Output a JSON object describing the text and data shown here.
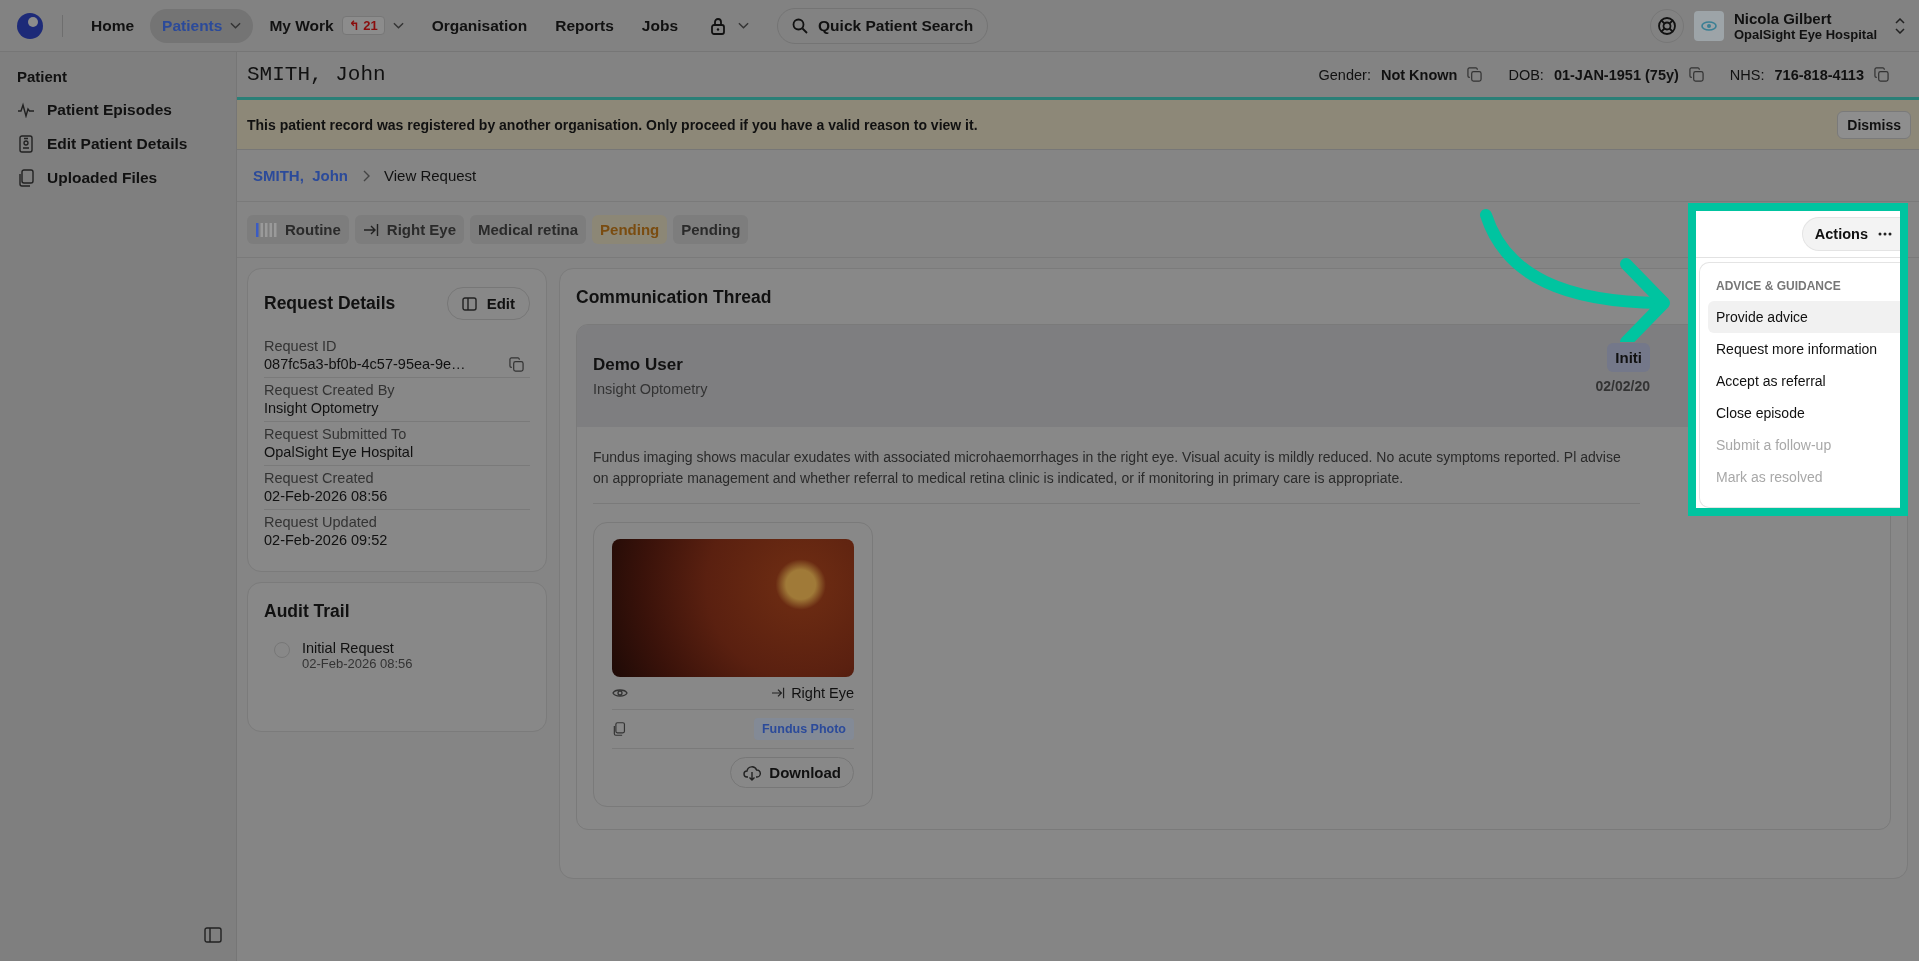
{
  "nav": {
    "items": [
      {
        "kind": "link",
        "label": "Home",
        "selected": false,
        "dropdown": false
      },
      {
        "kind": "link",
        "label": "Patients",
        "selected": true,
        "dropdown": true
      },
      {
        "kind": "work",
        "label": "My Work",
        "badge": "↰ 21",
        "selected": false,
        "dropdown": true
      },
      {
        "kind": "link",
        "label": "Organisation",
        "selected": false,
        "dropdown": false
      },
      {
        "kind": "link",
        "label": "Reports",
        "selected": false,
        "dropdown": false
      },
      {
        "kind": "link",
        "label": "Jobs",
        "selected": false,
        "dropdown": false
      },
      {
        "kind": "lock",
        "selected": false,
        "dropdown": true
      }
    ],
    "search": "Quick Patient Search"
  },
  "user": {
    "name": "Nicola Gilbert",
    "org": "OpalSight Eye Hospital"
  },
  "sidebar": {
    "heading": "Patient",
    "items": [
      {
        "kind": "episodes",
        "label": "Patient Episodes"
      },
      {
        "kind": "edit",
        "label": "Edit Patient Details"
      },
      {
        "kind": "files",
        "label": "Uploaded Files"
      }
    ]
  },
  "patient": {
    "name": "SMITH, John",
    "fields": [
      {
        "label": "Gender:",
        "value": "Not Known"
      },
      {
        "label": "DOB:",
        "value": "01-JAN-1951 (75y)"
      },
      {
        "label": "NHS:",
        "value": "716-818-4113"
      }
    ]
  },
  "banner": {
    "message": "This patient record was registered by another organisation. Only proceed if you have a valid reason to view it.",
    "dismiss": "Dismiss"
  },
  "breadcrumb": [
    {
      "label": "SMITH,  John",
      "link": true
    },
    {
      "label": "View Request",
      "link": false
    }
  ],
  "tags": [
    {
      "kind": "priority",
      "label": "Routine"
    },
    {
      "kind": "eye",
      "label": "Right Eye"
    },
    {
      "kind": "plain",
      "label": "Medical retina"
    },
    {
      "kind": "warning",
      "label": "Pending"
    },
    {
      "kind": "plain",
      "label": "Pending"
    }
  ],
  "request_details": {
    "title": "Request Details",
    "edit": "Edit",
    "fields": [
      {
        "label": "Request ID",
        "value": "087fc5a3-bf0b-4c57-95ea-9e…",
        "copy": true
      },
      {
        "label": "Request Created By",
        "value": "Insight Optometry",
        "copy": false
      },
      {
        "label": "Request Submitted To",
        "value": "OpalSight Eye Hospital",
        "copy": false
      },
      {
        "label": "Request Created",
        "value": "02-Feb-2026 08:56",
        "copy": false
      },
      {
        "label": "Request Updated",
        "value": "02-Feb-2026 09:52",
        "copy": false
      }
    ]
  },
  "audit": {
    "title": "Audit Trail",
    "entries": [
      {
        "title": "Initial Request",
        "date": "02-Feb-2026 08:56"
      }
    ]
  },
  "thread": {
    "title": "Communication Thread",
    "message": {
      "author": "Demo User",
      "org": "Insight Optometry",
      "badge": "Initi",
      "date": "02/02/20",
      "body": "Fundus imaging shows macular exudates with associated microhaemorrhages in the right eye. Visual acuity is mildly reduced. No acute symptoms reported. Pl advise on appropriate management and whether referral to medical retina clinic is indicated, or if monitoring in primary care is appropriate."
    },
    "attachment": {
      "eye": "Right Eye",
      "type": "Fundus Photo",
      "download": "Download"
    }
  },
  "actions": {
    "button": "Actions",
    "section": "ADVICE & GUIDANCE",
    "items": [
      {
        "label": "Provide advice",
        "selected": true,
        "disabled": false
      },
      {
        "label": "Request more information",
        "selected": false,
        "disabled": false
      },
      {
        "label": "Accept as referral",
        "selected": false,
        "disabled": false
      },
      {
        "label": "Close episode",
        "selected": false,
        "disabled": false
      },
      {
        "label": "Submit a follow-up",
        "selected": false,
        "disabled": true
      },
      {
        "label": "Mark as resolved",
        "selected": false,
        "disabled": true
      }
    ]
  }
}
